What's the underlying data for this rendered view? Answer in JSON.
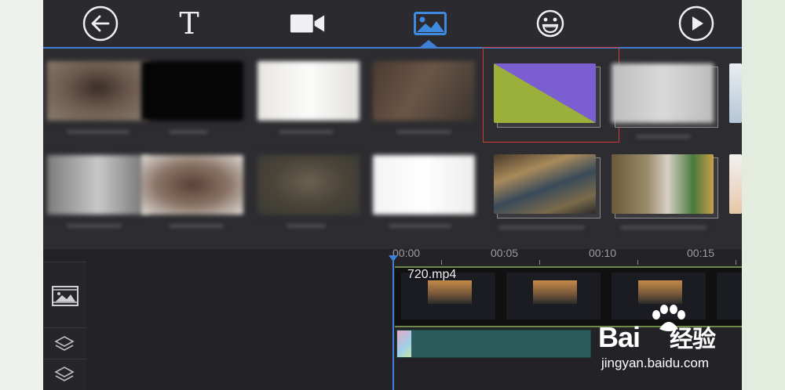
{
  "toolbar": {
    "items": [
      {
        "name": "back",
        "icon": "arrow-left-circle-icon"
      },
      {
        "name": "text",
        "icon": "text-T-icon",
        "label": "T"
      },
      {
        "name": "video",
        "icon": "video-camera-icon"
      },
      {
        "name": "image",
        "icon": "image-icon",
        "active": true
      },
      {
        "name": "sticker",
        "icon": "smiley-icon"
      },
      {
        "name": "play",
        "icon": "play-circle-icon"
      }
    ],
    "accent": "#3f7fd6"
  },
  "media_browser": {
    "rows": 2,
    "selected_item": "gradient-purple-yellow",
    "selection_border": "#d23a3a"
  },
  "timeline": {
    "ticks": [
      "00:00",
      "00:05",
      "00:10",
      "00:15"
    ],
    "clip_name": "720.mp4",
    "track_icons": [
      "image-track-icon",
      "layers-icon",
      "layers-icon"
    ]
  },
  "watermark": {
    "brand": "Bai",
    "brand_cn": "经验",
    "url": "jingyan.baidu.com"
  }
}
